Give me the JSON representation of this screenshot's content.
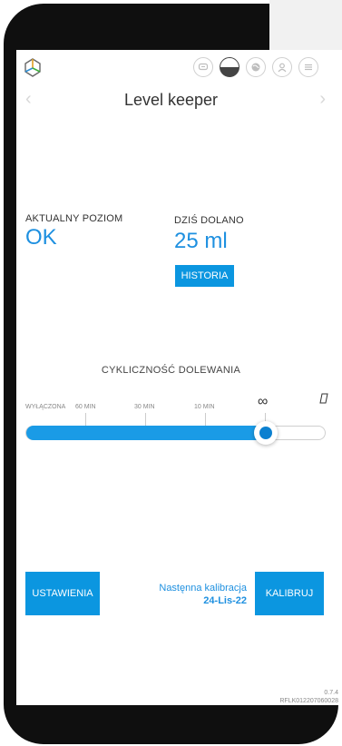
{
  "header": {
    "title": "Level keeper",
    "icons": [
      "logo-icon",
      "chat-icon",
      "level-icon",
      "globe-icon",
      "user-icon",
      "menu-icon"
    ]
  },
  "status": {
    "current_level_label": "AKTUALNY POZIOM",
    "current_level_value": "OK",
    "today_added_label": "DZIŚ DOLANO",
    "today_added_value": "25 ml",
    "history_button": "HISTORIA"
  },
  "cycle": {
    "title": "CYKLICZNOŚĆ DOLEWANIA",
    "ticks": [
      "WYŁĄCZONA",
      "60 MIN",
      "30 MIN",
      "10 MIN"
    ],
    "infinity_label": "∞",
    "manual_label": "[]",
    "slider_value": 0.8
  },
  "footer": {
    "settings_button": "USTAWIENIA",
    "next_calibration_label": "Nastęnna kalibracja",
    "next_calibration_date": "24-Lis-22",
    "calibrate_button": "KALIBRUJ",
    "version": "0.7.4",
    "serial": "RFLK012207060028"
  },
  "colors": {
    "accent": "#0b96e0",
    "text_accent": "#1e90e0",
    "frame": "#0f0f0f"
  }
}
